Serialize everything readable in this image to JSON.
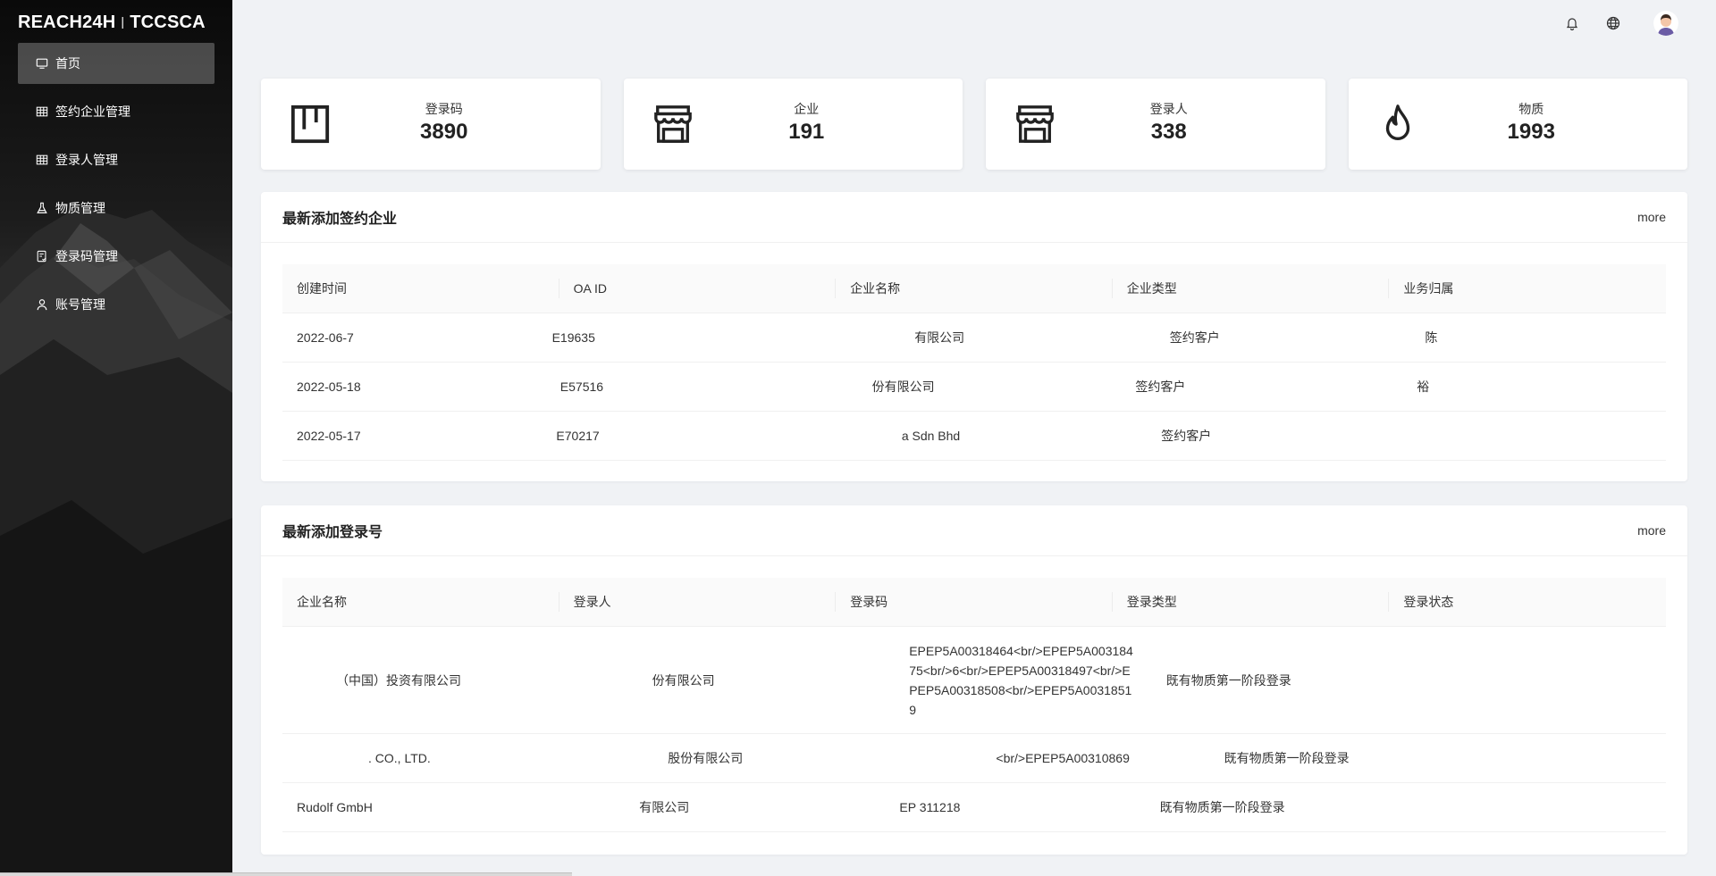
{
  "app": {
    "logo_left": "REACH24H",
    "logo_sep": "|",
    "logo_right": "TCCSCA"
  },
  "sidebar": {
    "items": [
      {
        "label": "首页",
        "icon": "monitor-icon",
        "active": true
      },
      {
        "label": "签约企业管理",
        "icon": "table-icon",
        "active": false
      },
      {
        "label": "登录人管理",
        "icon": "table-icon",
        "active": false
      },
      {
        "label": "物质管理",
        "icon": "flask-icon",
        "active": false
      },
      {
        "label": "登录码管理",
        "icon": "file-check-icon",
        "active": false
      },
      {
        "label": "账号管理",
        "icon": "user-icon",
        "active": false
      }
    ]
  },
  "header": {
    "icons": [
      "bell-icon",
      "globe-icon",
      "avatar"
    ]
  },
  "stats": [
    {
      "label": "登录码",
      "value": "3890",
      "icon": "registration-icon"
    },
    {
      "label": "企业",
      "value": "191",
      "icon": "shop-icon"
    },
    {
      "label": "登录人",
      "value": "338",
      "icon": "shop-icon"
    },
    {
      "label": "物质",
      "value": "1993",
      "icon": "fire-icon"
    }
  ],
  "companies_panel": {
    "title": "最新添加签约企业",
    "more": "more",
    "columns": [
      "创建时间",
      "OA ID",
      "企业名称",
      "企业类型",
      "业务归属"
    ],
    "rows": [
      [
        "2022-06-7",
        "E19635",
        "有限公司",
        "签约客户",
        "陈"
      ],
      [
        "2022-05-18",
        "E57516",
        "份有限公司",
        "签约客户",
        "裕"
      ],
      [
        "2022-05-17",
        "E70217",
        "a Sdn Bhd",
        "签约客户",
        ""
      ]
    ]
  },
  "registrations_panel": {
    "title": "最新添加登录号",
    "more": "more",
    "columns": [
      "企业名称",
      "登录人",
      "登录码",
      "登录类型",
      "登录状态"
    ],
    "rows": [
      [
        "（中国）投资有限公司",
        "份有限公司",
        "EPEP5A00318464<br/>EPEP5A00318475<br/>6<br/>EPEP5A00318497<br/>EPEP5A00318508<br/>EPEP5A00318519",
        "既有物质第一阶段登录",
        ""
      ],
      [
        ". CO., LTD.",
        "股份有限公司",
        "<br/>EPEP5A00310869",
        "既有物质第一阶段登录",
        ""
      ],
      [
        "Rudolf GmbH",
        "有限公司",
        "EP 311218",
        "既有物质第一阶段登录",
        ""
      ]
    ]
  },
  "colors": {
    "sidebar_bg": "#1a1a1a",
    "page_bg": "#f0f2f5",
    "card_bg": "#ffffff"
  }
}
